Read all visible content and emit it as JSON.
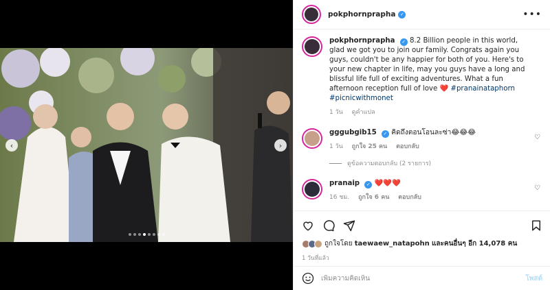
{
  "post": {
    "username": "pokphornprapha",
    "more_label": "•••",
    "carousel": {
      "slide_count": 8,
      "active_slide": 4,
      "prev_label": "‹",
      "next_label": "›"
    }
  },
  "caption": {
    "username": "pokphornprapha",
    "text": "8.2 Billion people in this world, glad we got you to join our family. Congrats again you guys, couldn't be any happier for both of you. Here's to your new chapter in life, may you guys have a long and blissful life full of exciting adventures. What a fun afternoon reception full of love ",
    "heart": "❤️",
    "hashtag1": "#pranainataphorn",
    "hashtag2": "#picnicwithmonet",
    "time": "1 วัน",
    "translate": "ดูคำแปล"
  },
  "comments": [
    {
      "username": "gggubgib15",
      "text": "คิดถึงตอนโอนละซ่า😂😂😂",
      "time": "1 วัน",
      "likes": "ถูกใจ 25 คน",
      "reply": "ตอบกลับ",
      "view_replies": "ดูข้อความตอบกลับ (2 รายการ)"
    },
    {
      "username": "pranaip",
      "text": "❤️❤️❤️",
      "time": "16 ชม.",
      "likes": "ถูกใจ 6 คน",
      "reply": "ตอบกลับ"
    }
  ],
  "likes_summary": {
    "prefix": "ถูกใจโดย",
    "user": "taewaew_natapohn",
    "suffix": "และคนอื่นๆ อีก 14,078 คน"
  },
  "posted_ago": "1 วันที่แล้ว",
  "add_comment": {
    "placeholder": "เพิ่มความคิดเห็น",
    "post_label": "โพสต์"
  },
  "icons": [
    "heart-icon",
    "comment-icon",
    "share-icon",
    "save-icon",
    "emoji-icon",
    "verified-icon",
    "more-icon"
  ],
  "colors": {
    "verified": "#3897f0",
    "link": "#00376b",
    "post_button": "#b2dffc",
    "story_ring": "#d6249f"
  }
}
